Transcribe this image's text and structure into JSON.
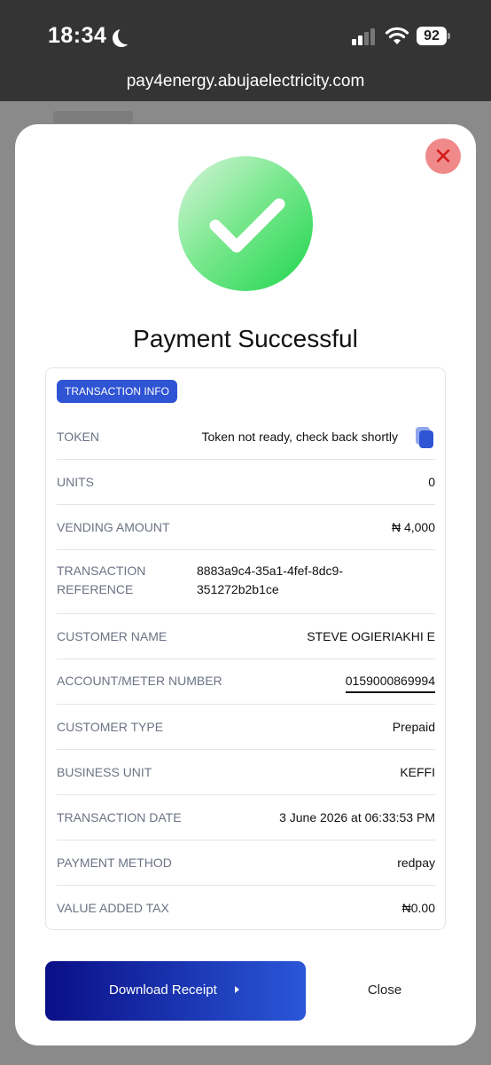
{
  "status_bar": {
    "time": "18:34",
    "battery": "92"
  },
  "browser": {
    "url": "pay4energy.abujaelectricity.com"
  },
  "modal": {
    "close_symbol": "✕",
    "title": "Payment Successful",
    "badge": "TRANSACTION INFO",
    "rows": [
      {
        "label": "TOKEN",
        "value": "Token not ready, check back shortly"
      },
      {
        "label": "UNITS",
        "value": "0"
      },
      {
        "label": "VENDING AMOUNT",
        "value": "₦ 4,000"
      },
      {
        "label_line1": "TRANSACTION",
        "label_line2": "REFERENCE",
        "value_line1": "8883a9c4-35a1-4fef-8dc9-",
        "value_line2": "351272b2b1ce"
      },
      {
        "label": "CUSTOMER NAME",
        "value": "STEVE OGIERIAKHI E"
      },
      {
        "label": "ACCOUNT/METER NUMBER",
        "value": "0159000869994"
      },
      {
        "label": "CUSTOMER TYPE",
        "value": "Prepaid"
      },
      {
        "label": "BUSINESS UNIT",
        "value": "KEFFI"
      },
      {
        "label": "TRANSACTION DATE",
        "value": "3 June 2026 at 06:33:53 PM"
      },
      {
        "label": "PAYMENT METHOD",
        "value": "redpay"
      },
      {
        "label": "VALUE ADDED TAX",
        "value": "₦0.00"
      }
    ],
    "download_label": "Download Receipt",
    "close_label": "Close"
  },
  "icons": [
    "moon-icon",
    "signal-icon",
    "wifi-icon",
    "battery-icon",
    "close-icon",
    "checkmark-icon",
    "copy-icon",
    "caret-right-icon"
  ],
  "colors": {
    "success_green": "#1fd64e",
    "primary_blue": "#2f54d4",
    "close_red": "#d21b1b",
    "button_dark": "#0a0f86"
  }
}
